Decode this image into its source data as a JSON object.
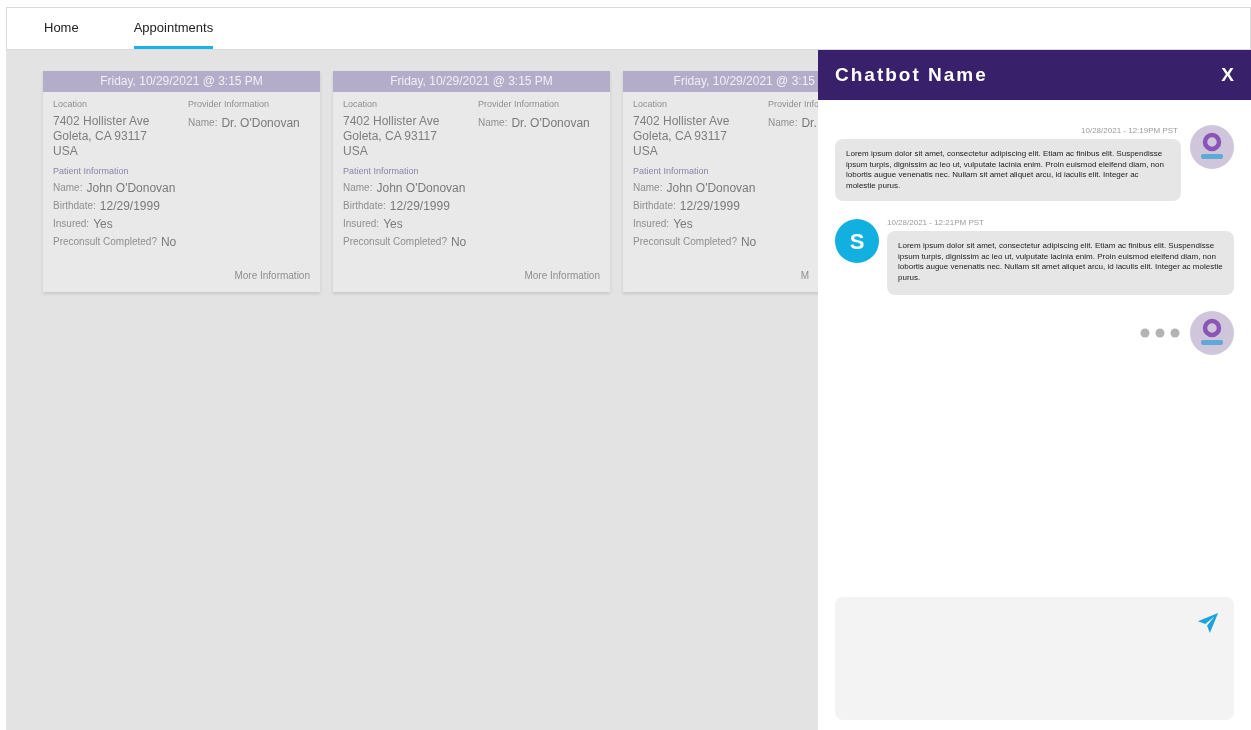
{
  "nav": {
    "tabs": [
      {
        "label": "Home",
        "selected": false
      },
      {
        "label": "Appointments",
        "selected": true
      }
    ]
  },
  "appointments": [
    {
      "date": "Friday, 10/29/2021 @ 3:15 PM",
      "location_label": "Location",
      "address": [
        "7402 Hollister Ave",
        "Goleta, CA 93117",
        "USA"
      ],
      "provider_label": "Provider Information",
      "provider_fields": [
        {
          "label": "Name:",
          "value": "Dr. O'Donovan"
        }
      ],
      "patient_label": "Patient Information",
      "patient_fields": [
        {
          "label": "Name:",
          "value": "John O'Donovan"
        },
        {
          "label": "Birthdate:",
          "value": "12/29/1999"
        },
        {
          "label": "Insured:",
          "value": "Yes"
        },
        {
          "label": "Preconsult Completed?",
          "value": "No"
        }
      ],
      "more": "More Information",
      "clipped": false
    },
    {
      "date": "Friday, 10/29/2021 @ 3:15 PM",
      "location_label": "Location",
      "address": [
        "7402 Hollister Ave",
        "Goleta, CA 93117",
        "USA"
      ],
      "provider_label": "Provider Information",
      "provider_fields": [
        {
          "label": "Name:",
          "value": "Dr. O'Donovan"
        }
      ],
      "patient_label": "Patient Information",
      "patient_fields": [
        {
          "label": "Name:",
          "value": "John O'Donovan"
        },
        {
          "label": "Birthdate:",
          "value": "12/29/1999"
        },
        {
          "label": "Insured:",
          "value": "Yes"
        },
        {
          "label": "Preconsult Completed?",
          "value": "No"
        }
      ],
      "more": "More Information",
      "clipped": false
    },
    {
      "date": "Friday, 10/29/2021 @ 3:15",
      "location_label": "Location",
      "address": [
        "7402 Hollister Ave",
        "Goleta, CA 93117",
        "USA"
      ],
      "provider_label": "Provider Info",
      "provider_fields": [
        {
          "label": "Name:",
          "value": "Dr."
        }
      ],
      "patient_label": "Patient Information",
      "patient_fields": [
        {
          "label": "Name:",
          "value": "John O'Donovan"
        },
        {
          "label": "Birthdate:",
          "value": "12/29/1999"
        },
        {
          "label": "Insured:",
          "value": "Yes"
        },
        {
          "label": "Preconsult Completed?",
          "value": "No"
        }
      ],
      "more": "M",
      "clipped": true
    }
  ],
  "chat": {
    "title": "Chatbot Name",
    "close": "X",
    "messages": [
      {
        "kind": "bot",
        "time": "10/28/2021 - 12:19PM PST",
        "text": "Lorem ipsum dolor sit amet, consectetur adipiscing elit. Etiam ac finibus elit. Suspendisse ipsum turpis, dignissim ac leo ut, vulputate lacinia enim. Proin euismod eleifend diam, non lobortis augue venenatis nec. Nullam sit amet aliquet arcu, id iaculis elit. Integer ac molestie purus."
      },
      {
        "kind": "user",
        "avatar": "S",
        "time": "10/28/2021 - 12:21PM PST",
        "text": "Lorem ipsum dolor sit amet, consectetur adipiscing elit. Etiam ac finibus elit. Suspendisse ipsum turpis, dignissim ac leo ut, vulputate lacinia enim. Proin euismod eleifend diam, non lobortis augue venenatis nec. Nullam sit amet aliquet arcu, id iaculis elit. Integer ac molestie purus."
      }
    ],
    "typing": true
  }
}
